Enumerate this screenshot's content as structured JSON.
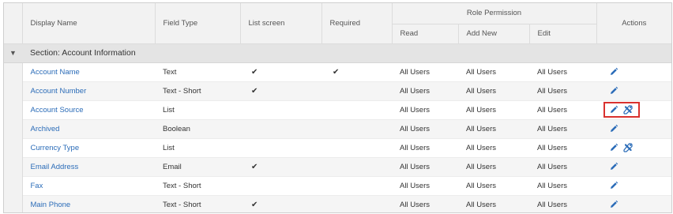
{
  "header": {
    "display_name": "Display Name",
    "field_type": "Field Type",
    "list_screen": "List screen",
    "required": "Required",
    "role_permission": "Role Permission",
    "read": "Read",
    "add_new": "Add New",
    "edit": "Edit",
    "actions": "Actions"
  },
  "section": {
    "title": "Section: Account Information",
    "chevron": "chevron-down-icon"
  },
  "rows": [
    {
      "name": "Account Name",
      "type": "Text",
      "list_screen": "✔",
      "required": "✔",
      "read": "All Users",
      "add_new": "All Users",
      "edit": "All Users",
      "actions": [
        "edit-icon"
      ]
    },
    {
      "name": "Account Number",
      "type": "Text - Short",
      "list_screen": "✔",
      "required": "",
      "read": "All Users",
      "add_new": "All Users",
      "edit": "All Users",
      "actions": [
        "edit-icon"
      ]
    },
    {
      "name": "Account Source",
      "type": "List",
      "list_screen": "",
      "required": "",
      "read": "All Users",
      "add_new": "All Users",
      "edit": "All Users",
      "actions": [
        "edit-icon",
        "tools-icon"
      ],
      "highlighted": true
    },
    {
      "name": "Archived",
      "type": "Boolean",
      "list_screen": "",
      "required": "",
      "read": "All Users",
      "add_new": "All Users",
      "edit": "All Users",
      "actions": [
        "edit-icon"
      ]
    },
    {
      "name": "Currency Type",
      "type": "List",
      "list_screen": "",
      "required": "",
      "read": "All Users",
      "add_new": "All Users",
      "edit": "All Users",
      "actions": [
        "edit-icon",
        "tools-icon"
      ]
    },
    {
      "name": "Email Address",
      "type": "Email",
      "list_screen": "✔",
      "required": "",
      "read": "All Users",
      "add_new": "All Users",
      "edit": "All Users",
      "actions": [
        "edit-icon"
      ]
    },
    {
      "name": "Fax",
      "type": "Text - Short",
      "list_screen": "",
      "required": "",
      "read": "All Users",
      "add_new": "All Users",
      "edit": "All Users",
      "actions": [
        "edit-icon"
      ]
    },
    {
      "name": "Main Phone",
      "type": "Text - Short",
      "list_screen": "✔",
      "required": "",
      "read": "All Users",
      "add_new": "All Users",
      "edit": "All Users",
      "actions": [
        "edit-icon"
      ]
    }
  ],
  "colors": {
    "link": "#2b6cb8",
    "icon": "#2b6cb8",
    "highlight_border": "#d9312e",
    "section_bg": "#e4e4e4",
    "header_bg": "#f2f2f2"
  }
}
